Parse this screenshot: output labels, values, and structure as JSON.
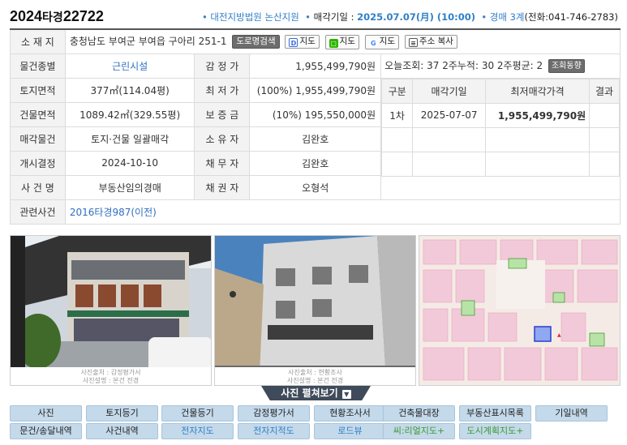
{
  "header": {
    "case_year": "2024",
    "case_type": "타경",
    "case_num": "22722",
    "court": "대전지방법원 논산지원",
    "auction_date_label": "매각기일 : ",
    "auction_date": "2025.07.07(月) (10:00)",
    "dept_label": "경매 3계",
    "phone": "(전화:041-746-2783)"
  },
  "address": {
    "label": "소 재 지",
    "value": "충청남도 부여군 부여읍 구아리 251-1",
    "buttons": [
      "도로명검색",
      "지도",
      "지도",
      "지도",
      "주소 복사"
    ]
  },
  "rows": [
    {
      "label": "물건종별",
      "value": "근린시설",
      "label2": "감 정 가",
      "value2": "1,955,499,790원"
    },
    {
      "label": "토지면적",
      "value": "377㎡(114.04평)",
      "label2": "최 저 가",
      "value2": "(100%) 1,955,499,790원"
    },
    {
      "label": "건물면적",
      "value": "1089.42㎡(329.55평)",
      "label2": "보 증 금",
      "value2": "(10%) 195,550,000원"
    },
    {
      "label": "매각물건",
      "value": "토지·건물 일괄매각",
      "label2": "소 유 자",
      "value2": "김완호"
    },
    {
      "label": "개시결정",
      "value": "2024-10-10",
      "label2": "채 무 자",
      "value2": "김완호"
    },
    {
      "label": "사 건 명",
      "value": "부동산임의경매",
      "label2": "채 권 자",
      "value2": "오형석"
    }
  ],
  "related": {
    "label": "관련사건",
    "value": "2016타경987(이전)"
  },
  "stats": {
    "text": "오늘조회: 37  2주누적: 30  2주평균: 2",
    "button": "조회동향"
  },
  "schedule": {
    "headers": [
      "구분",
      "매각기일",
      "최저매각가격",
      "결과"
    ],
    "rows": [
      [
        "1차",
        "2025-07-07",
        "1,955,499,790원",
        ""
      ]
    ]
  },
  "photo_captions": [
    [
      "사진출처 : 감정평가서",
      "사진설명 : 본건 전경"
    ],
    [
      "사진출처 : 현황조사",
      "사진설명 : 본건 전경"
    ]
  ],
  "unfold_label": "사진 펼쳐보기",
  "tabs_row1": [
    "사진",
    "토지등기",
    "건물등기",
    "감정평가서",
    "현황조사서",
    "건축물대장",
    "부동산표시목록",
    "기일내역"
  ],
  "tabs_row2": [
    "문건/송달내역",
    "사건내역",
    "전자지도",
    "전자지적도",
    "로드뷰",
    "씨:리얼지도+",
    "도시계획지도+"
  ],
  "colors": {
    "accent": "#2f7fc8",
    "tab_bg": "#c4d9ea",
    "green": "#3a9a2e"
  }
}
